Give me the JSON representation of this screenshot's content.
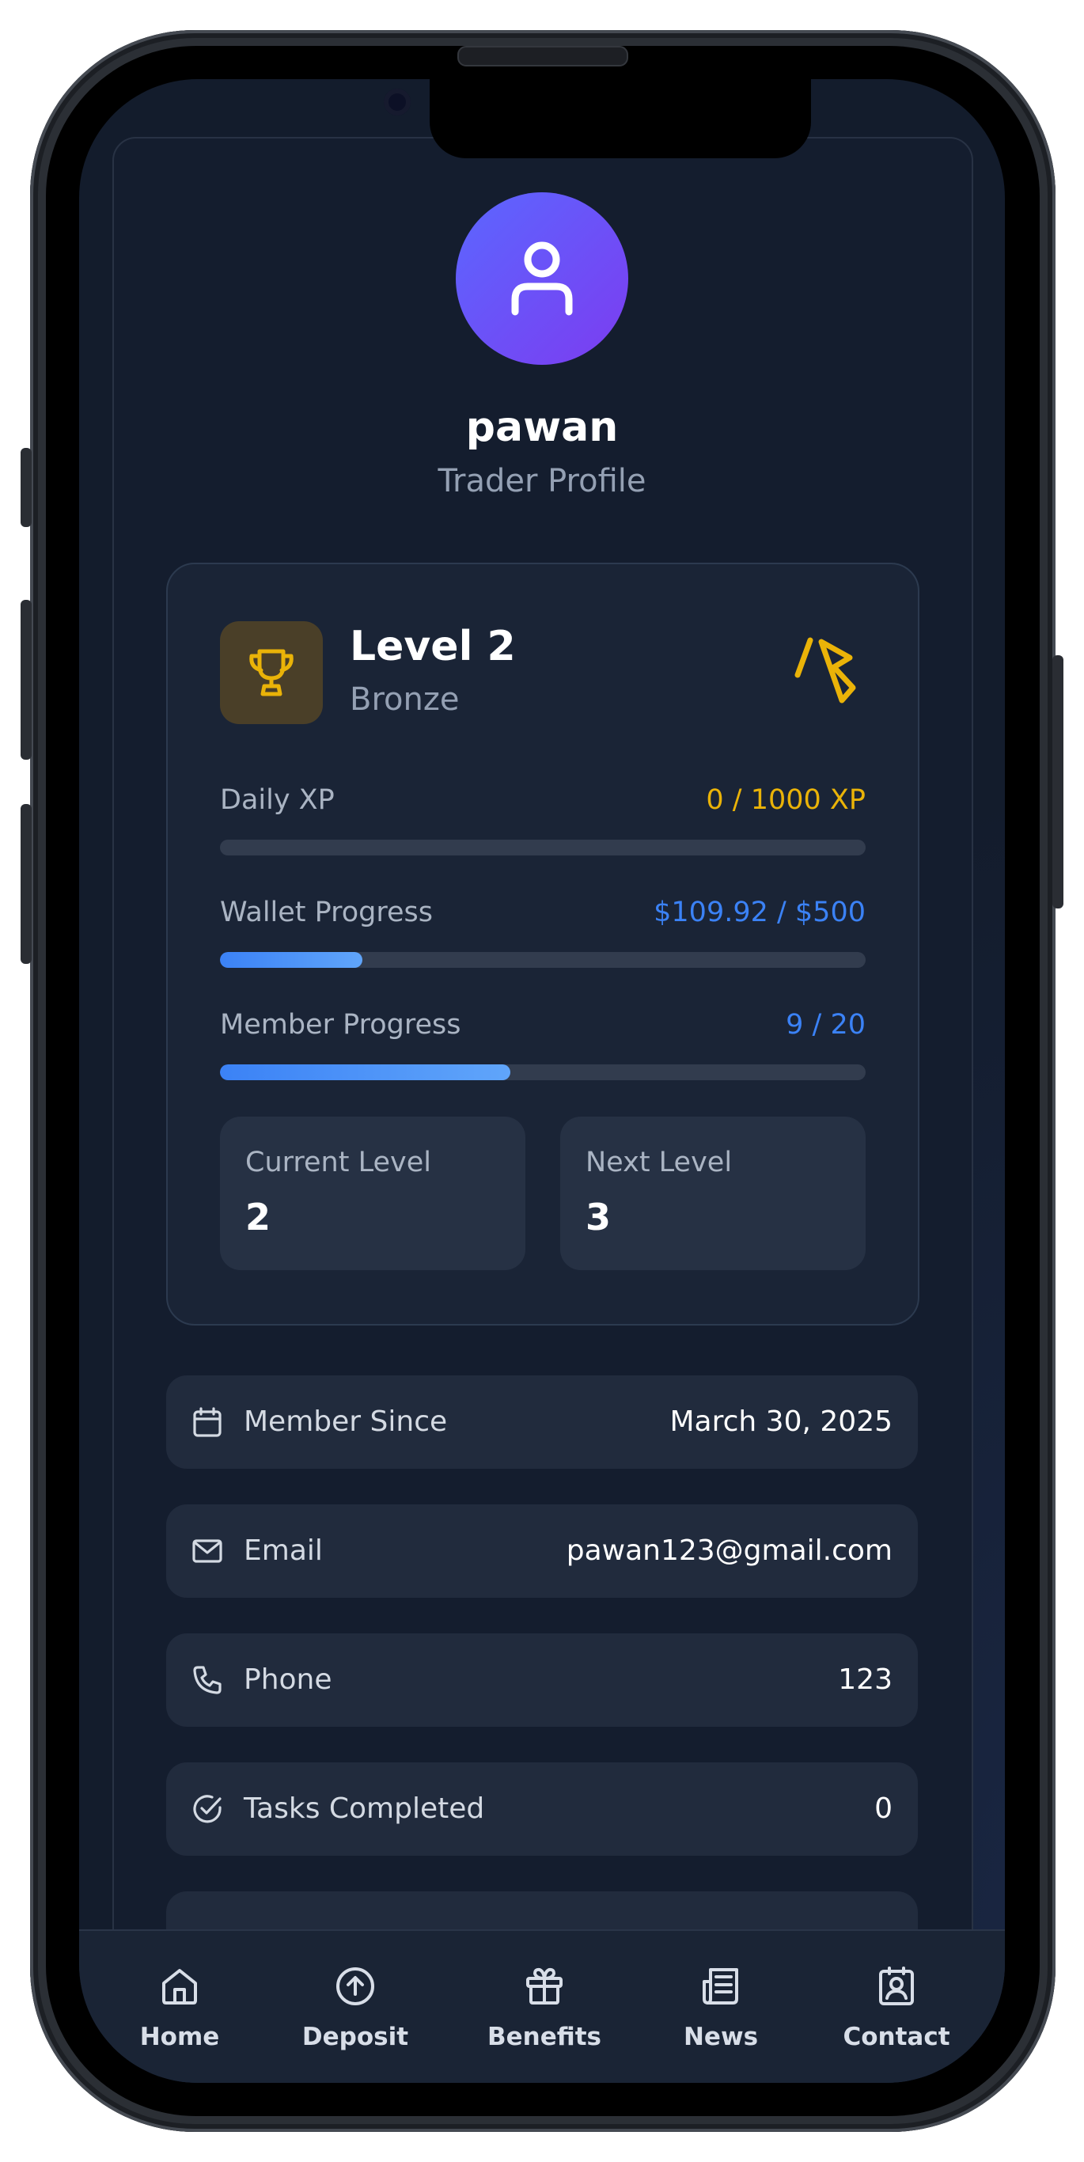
{
  "profile": {
    "username": "pawan",
    "subtitle": "Trader Profile"
  },
  "level": {
    "title": "Level 2",
    "tier": "Bronze",
    "progress": [
      {
        "label": "Daily XP",
        "value": "0 / 1000 XP",
        "fraction": 0.0
      },
      {
        "label": "Wallet Progress",
        "value": "$109.92 / $500",
        "fraction": 0.22
      },
      {
        "label": "Member Progress",
        "value": "9 / 20",
        "fraction": 0.45
      }
    ],
    "current": {
      "label": "Current Level",
      "value": "2"
    },
    "next": {
      "label": "Next Level",
      "value": "3"
    }
  },
  "info": [
    {
      "icon": "calendar-icon",
      "label": "Member Since",
      "value": "March 30, 2025"
    },
    {
      "icon": "mail-icon",
      "label": "Email",
      "value": "pawan123@gmail.com"
    },
    {
      "icon": "phone-icon",
      "label": "Phone",
      "value": "123"
    },
    {
      "icon": "check-circle-icon",
      "label": "Tasks Completed",
      "value": "0"
    }
  ],
  "nav": [
    {
      "icon": "home-icon",
      "label": "Home"
    },
    {
      "icon": "deposit-icon",
      "label": "Deposit"
    },
    {
      "icon": "gift-icon",
      "label": "Benefits"
    },
    {
      "icon": "newspaper-icon",
      "label": "News"
    },
    {
      "icon": "contact-icon",
      "label": "Contact"
    }
  ],
  "colors": {
    "accent_gold": "#eab308",
    "accent_blue": "#3b82f6",
    "avatar_start": "#5b67ff",
    "avatar_end": "#7c3cf0"
  }
}
